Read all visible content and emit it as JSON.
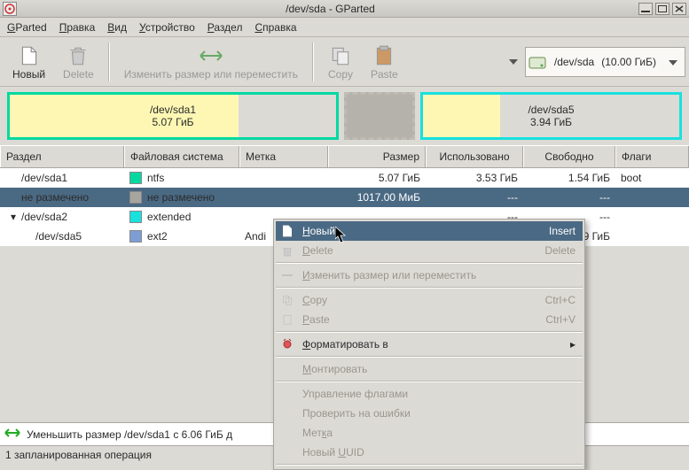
{
  "window": {
    "title": "/dev/sda - GParted"
  },
  "menubar": {
    "app": {
      "pre": "",
      "mnem": "G",
      "post": "Parted"
    },
    "edit": {
      "pre": "",
      "mnem": "П",
      "post": "равка"
    },
    "view": {
      "pre": "",
      "mnem": "В",
      "post": "ид"
    },
    "device": {
      "pre": "",
      "mnem": "У",
      "post": "стройство"
    },
    "partition": {
      "pre": "",
      "mnem": "Р",
      "post": "аздел"
    },
    "help": {
      "pre": "",
      "mnem": "С",
      "post": "правка"
    }
  },
  "toolbar": {
    "new": "Новый",
    "delete": "Delete",
    "resize": "Изменить размер или переместить",
    "copy": "Copy",
    "paste": "Paste"
  },
  "deviceSelector": {
    "device": "/dev/sda",
    "size": "(10.00 ГиБ)"
  },
  "diskmap": {
    "sda1": {
      "name": "/dev/sda1",
      "size": "5.07 ГиБ",
      "usedPct": 70
    },
    "sda5": {
      "name": "/dev/sda5",
      "size": "3.94 ГиБ",
      "usedPct": 30
    }
  },
  "columns": {
    "partition": "Раздел",
    "fs": "Файловая система",
    "label": "Метка",
    "size": "Размер",
    "used": "Использовано",
    "free": "Свободно",
    "flags": "Флаги"
  },
  "rows": [
    {
      "indent": 0,
      "expander": "",
      "name": "/dev/sda1",
      "fscolor": "#02d9a1",
      "fs": "ntfs",
      "label": "",
      "size": "5.07 ГиБ",
      "used": "3.53 ГиБ",
      "free": "1.54 ГиБ",
      "flags": "boot",
      "selected": false
    },
    {
      "indent": 0,
      "expander": "",
      "name": "не размечено",
      "fscolor": "#a8a59e",
      "fs": "не размечено",
      "label": "",
      "size": "1017.00 МиБ",
      "used": "---",
      "free": "---",
      "flags": "",
      "selected": true
    },
    {
      "indent": 0,
      "expander": "▾",
      "name": "/dev/sda2",
      "fscolor": "#18e1de",
      "fs": "extended",
      "label": "",
      "size": "",
      "used": "---",
      "free": "---",
      "flags": "",
      "selected": false
    },
    {
      "indent": 1,
      "expander": "",
      "name": "/dev/sda5",
      "fscolor": "#7e9dd4",
      "fs": "ext2",
      "label": "Andi",
      "size": "",
      "used": "",
      "free": "9 ГиБ",
      "flags": "",
      "selected": false
    }
  ],
  "context": {
    "new": {
      "pre": "",
      "mnem": "Н",
      "post": "овый",
      "acc": "Insert",
      "enabled": true,
      "selected": true
    },
    "delete": {
      "pre": "",
      "mnem": "D",
      "post": "elete",
      "acc": "Delete",
      "enabled": false
    },
    "resize": {
      "pre": "",
      "mnem": "И",
      "post": "зменить размер или переместить",
      "enabled": false
    },
    "copy": {
      "pre": "",
      "mnem": "C",
      "post": "opy",
      "acc": "Ctrl+C",
      "enabled": false
    },
    "paste": {
      "pre": "",
      "mnem": "P",
      "post": "aste",
      "acc": "Ctrl+V",
      "enabled": false
    },
    "format": {
      "pre": "",
      "mnem": "Ф",
      "post": "орматировать в",
      "enabled": true,
      "submenu": "▸"
    },
    "mount": {
      "pre": "",
      "mnem": "М",
      "post": "онтировать",
      "enabled": false
    },
    "flags": {
      "text": "Управление флагами",
      "enabled": false
    },
    "check": {
      "text": "Проверить на ошибки",
      "enabled": false
    },
    "label": {
      "pre": "Мет",
      "mnem": "к",
      "post": "а",
      "enabled": false
    },
    "uuid": {
      "pre": "Новый ",
      "mnem": "U",
      "post": "UID",
      "enabled": false
    }
  },
  "ops": {
    "pending": "Уменьшить размер /dev/sda1 с 6.06 ГиБ д"
  },
  "status": {
    "text": "1 запланированная операция"
  }
}
